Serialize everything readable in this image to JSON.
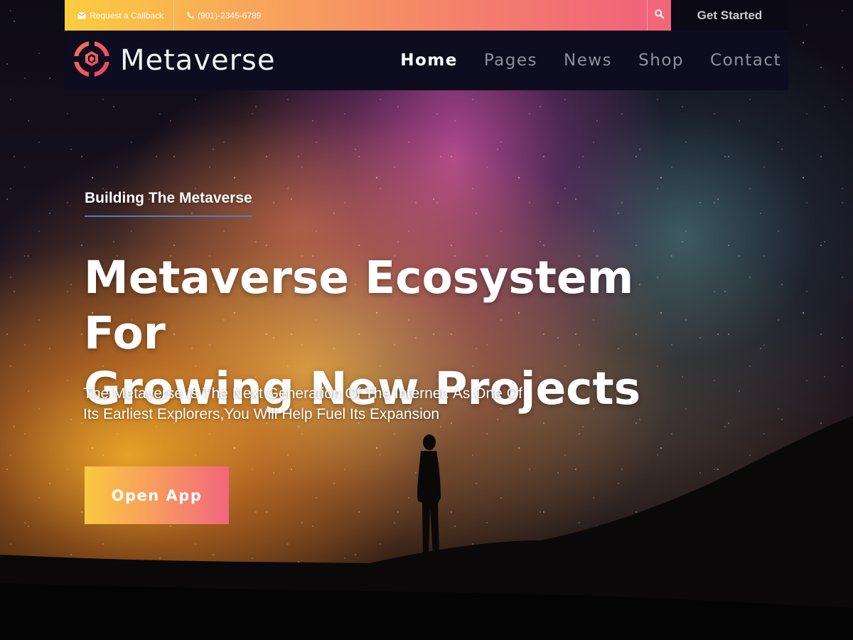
{
  "topbar": {
    "callback_label": "Request a Callback",
    "phone": "(901)-2345-6789",
    "get_started_label": "Get Started"
  },
  "nav": {
    "logo_text": "Metaverse",
    "links": [
      "Home",
      "Pages",
      "News",
      "Shop",
      "Contact"
    ],
    "active": "Home"
  },
  "hero": {
    "tagline": "Building The Metaverse",
    "headline_line1": "Metaverse Ecosystem For",
    "headline_line2": "Growing New Projects",
    "subtext_line1": "The Metaverse Is The Next Generation Of The Internet. As One Of",
    "subtext_line2": "Its Earliest Explorers,You Will Help Fuel Its Expansion",
    "cta_label": "Open App"
  },
  "colors": {
    "accent_start": "#fbc93f",
    "accent_end": "#f2667e",
    "nav_bg": "#0e0d1f",
    "underline": "#4a7fc9"
  },
  "icons": [
    "envelope-icon",
    "phone-icon",
    "search-icon",
    "logo-icon"
  ]
}
